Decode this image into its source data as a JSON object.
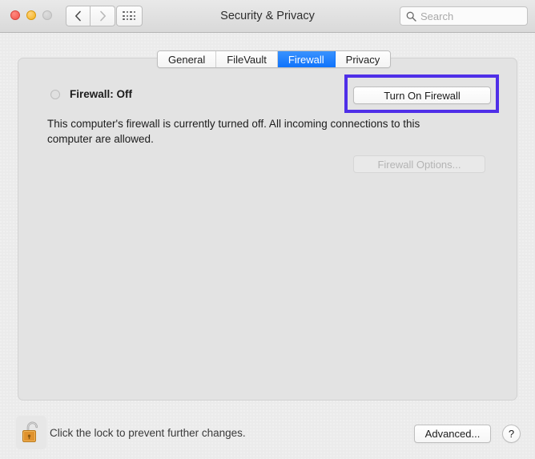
{
  "window": {
    "title": "Security & Privacy",
    "traffic_lights": [
      {
        "name": "close",
        "color": "#f2534a"
      },
      {
        "name": "minimize",
        "color": "#f2b21c"
      },
      {
        "name": "zoom",
        "color": "#c9c9c9"
      }
    ],
    "nav": {
      "back_icon": "chevron-left-icon",
      "forward_icon": "chevron-right-icon",
      "grid_icon": "show-all-grid-icon"
    }
  },
  "search": {
    "placeholder": "Search",
    "value": "",
    "icon": "search-icon"
  },
  "tabs": [
    {
      "label": "General",
      "selected": false
    },
    {
      "label": "FileVault",
      "selected": false
    },
    {
      "label": "Firewall",
      "selected": true
    },
    {
      "label": "Privacy",
      "selected": false
    }
  ],
  "firewall": {
    "status_label": "Firewall: Off",
    "status_state": "off",
    "status_indicator_color": "#e0e0e0",
    "turn_on_button": "Turn On Firewall",
    "options_button": "Firewall Options...",
    "options_button_disabled": true,
    "description": "This computer's firewall is currently turned off. All incoming connections to this computer are allowed."
  },
  "annotation": {
    "highlight_color": "#4f2fe8",
    "target": "Turn On Firewall"
  },
  "footer": {
    "lock_icon": "unlocked-padlock-icon",
    "lock_caption": "Click the lock to prevent further changes.",
    "advanced_button": "Advanced...",
    "help_button": "?"
  },
  "colors": {
    "accent_blue": "#1d7efd",
    "window_background": "#ebebeb",
    "panel_background": "#e3e3e3"
  }
}
